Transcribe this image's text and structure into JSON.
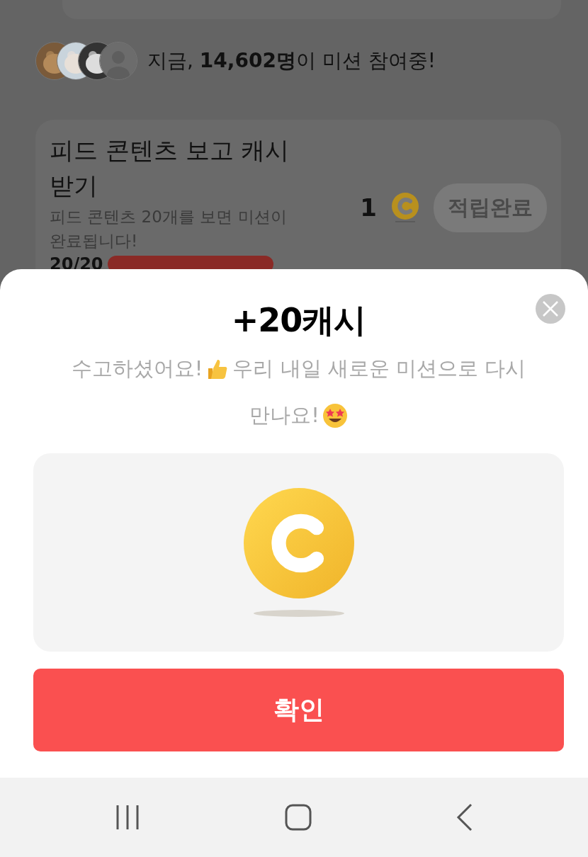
{
  "participants": {
    "prefix": "지금, ",
    "count": "14,602명",
    "suffix": "이 미션 참여중!"
  },
  "mission": {
    "title": "피드 콘텐츠 보고 캐시 받기",
    "description": "피드 콘텐츠 20개를 보면 미션이 완료됩니다!",
    "reward": "1",
    "button": "적립완료",
    "progress_text": "20/20",
    "level": 1
  },
  "sheet": {
    "title": "+20캐시",
    "message_line1_start": "수고하셨어요!",
    "message_line1_end": "우리 내일 새로운 미션으로 다시",
    "message_line2": "만나요!",
    "confirm": "확인"
  }
}
